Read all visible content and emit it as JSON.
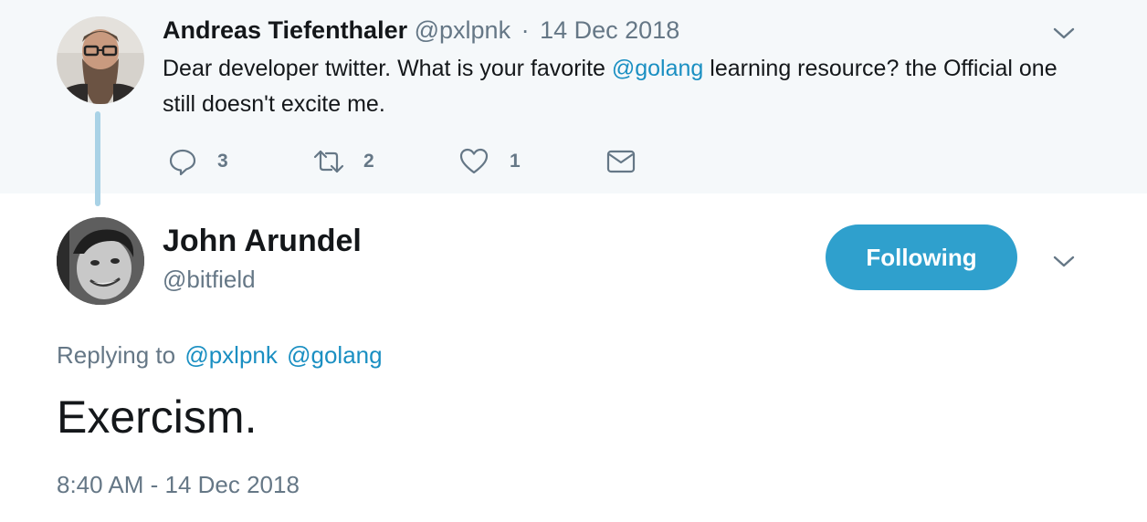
{
  "parent_tweet": {
    "author_name": "Andreas Tiefenthaler",
    "author_handle": "@pxlpnk",
    "separator": "·",
    "date": "14 Dec 2018",
    "text_before": "Dear developer twitter. What is your favorite ",
    "mention": "@golang",
    "text_after": " learning resource? the Official one still doesn't excite me.",
    "actions": {
      "reply_count": "3",
      "retweet_count": "2",
      "like_count": "1"
    }
  },
  "main_tweet": {
    "author_name": "John Arundel",
    "author_handle": "@bitfield",
    "follow_button_label": "Following",
    "replying_prefix": "Replying to",
    "replying_mentions": [
      "@pxlpnk",
      "@golang"
    ],
    "text": "Exercism.",
    "timestamp": "8:40 AM - 14 Dec 2018"
  },
  "icons": {
    "reply": "reply-icon",
    "retweet": "retweet-icon",
    "like": "heart-icon",
    "dm": "envelope-icon",
    "menu": "chevron-down-icon"
  },
  "colors": {
    "accent": "#1a8fc2",
    "follow_button": "#2fa0cd",
    "muted_text": "#657786",
    "parent_background": "#f5f8fa",
    "thread_line": "#a9d2e6"
  }
}
